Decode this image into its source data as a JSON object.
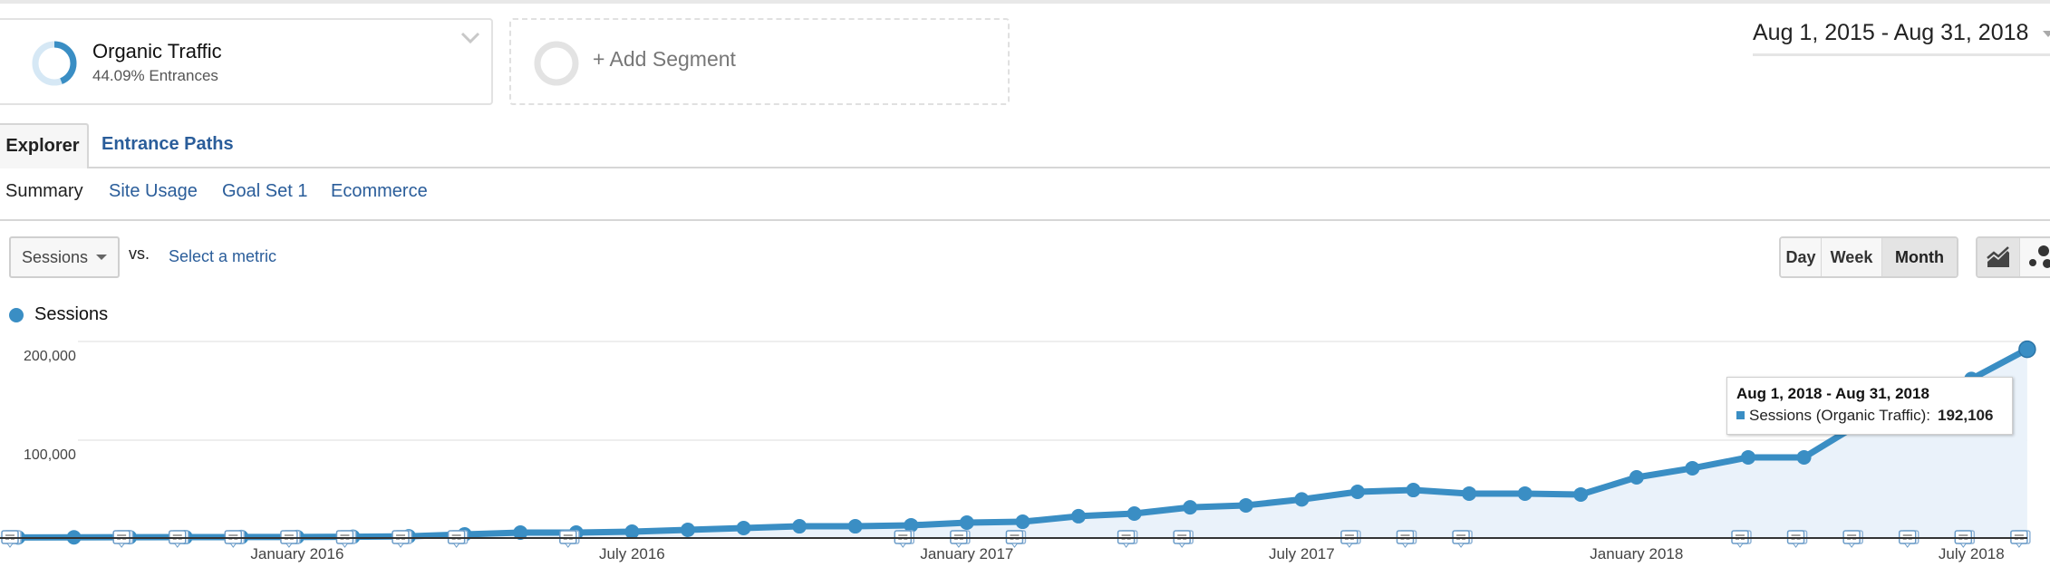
{
  "segments": {
    "active": {
      "name": "Organic Traffic",
      "subtitle": "44.09% Entrances",
      "ring_fill_fraction": 0.4409
    },
    "add_label": "+ Add Segment"
  },
  "date_range": "Aug 1, 2015 - Aug 31, 2018",
  "tabs": [
    {
      "label": "Explorer",
      "active": true
    },
    {
      "label": "Entrance Paths",
      "active": false
    }
  ],
  "subtabs": [
    {
      "label": "Summary",
      "active": true
    },
    {
      "label": "Site Usage",
      "active": false
    },
    {
      "label": "Goal Set 1",
      "active": false
    },
    {
      "label": "Ecommerce",
      "active": false
    }
  ],
  "metric_selector": {
    "selected": "Sessions",
    "vs_label": "vs.",
    "compare_placeholder": "Select a metric"
  },
  "period_buttons": [
    {
      "label": "Day",
      "active": false
    },
    {
      "label": "Week",
      "active": false
    },
    {
      "label": "Month",
      "active": true
    }
  ],
  "view_buttons": [
    {
      "icon": "line-chart-icon",
      "active": true
    },
    {
      "icon": "motion-chart-icon",
      "active": false
    }
  ],
  "colors": {
    "series": "#3a8ec4",
    "area": "#eaf2fa",
    "link": "#2a5d9a"
  },
  "tooltip": {
    "title": "Aug 1, 2018 - Aug 31, 2018",
    "series_label": "Sessions (Organic Traffic):",
    "value": "192,106"
  },
  "chart_data": {
    "type": "area",
    "title": "",
    "legend": [
      "Sessions"
    ],
    "legend_position": "top-left",
    "xlabel": "",
    "ylabel": "Sessions",
    "ylim": [
      0,
      200000
    ],
    "yticks": [
      {
        "value": 200000,
        "label": "200,000"
      },
      {
        "value": 100000,
        "label": "100,000"
      }
    ],
    "xtick_labels": [
      {
        "index": 5,
        "label": "January 2016"
      },
      {
        "index": 11,
        "label": "July 2016"
      },
      {
        "index": 17,
        "label": "January 2017"
      },
      {
        "index": 23,
        "label": "July 2017"
      },
      {
        "index": 29,
        "label": "January 2018"
      },
      {
        "index": 35,
        "label": "July 2018"
      }
    ],
    "grid": true,
    "x": [
      "Aug 2015",
      "Sep 2015",
      "Oct 2015",
      "Nov 2015",
      "Dec 2015",
      "Jan 2016",
      "Feb 2016",
      "Mar 2016",
      "Apr 2016",
      "May 2016",
      "Jun 2016",
      "Jul 2016",
      "Aug 2016",
      "Sep 2016",
      "Oct 2016",
      "Nov 2016",
      "Dec 2016",
      "Jan 2017",
      "Feb 2017",
      "Mar 2017",
      "Apr 2017",
      "May 2017",
      "Jun 2017",
      "Jul 2017",
      "Aug 2017",
      "Sep 2017",
      "Oct 2017",
      "Nov 2017",
      "Dec 2017",
      "Jan 2018",
      "Feb 2018",
      "Mar 2018",
      "Apr 2018",
      "May 2018",
      "Jun 2018",
      "Jul 2018",
      "Aug 2018"
    ],
    "series": [
      {
        "name": "Sessions (Organic Traffic)",
        "values": [
          1500,
          1600,
          1700,
          1800,
          1900,
          2000,
          2200,
          2600,
          4600,
          6400,
          6400,
          7300,
          9200,
          11000,
          12800,
          12800,
          13800,
          16500,
          17400,
          23000,
          25700,
          32000,
          34000,
          40000,
          47700,
          49500,
          45900,
          45900,
          45000,
          62400,
          71600,
          82600,
          82600,
          117000,
          142000,
          162000,
          192106
        ]
      }
    ],
    "annotation_marker_months": [
      0,
      2,
      3,
      4,
      5,
      6,
      7,
      8,
      10,
      16,
      17,
      18,
      20,
      21,
      24,
      25,
      26,
      31,
      32,
      33,
      34,
      35,
      36
    ]
  }
}
